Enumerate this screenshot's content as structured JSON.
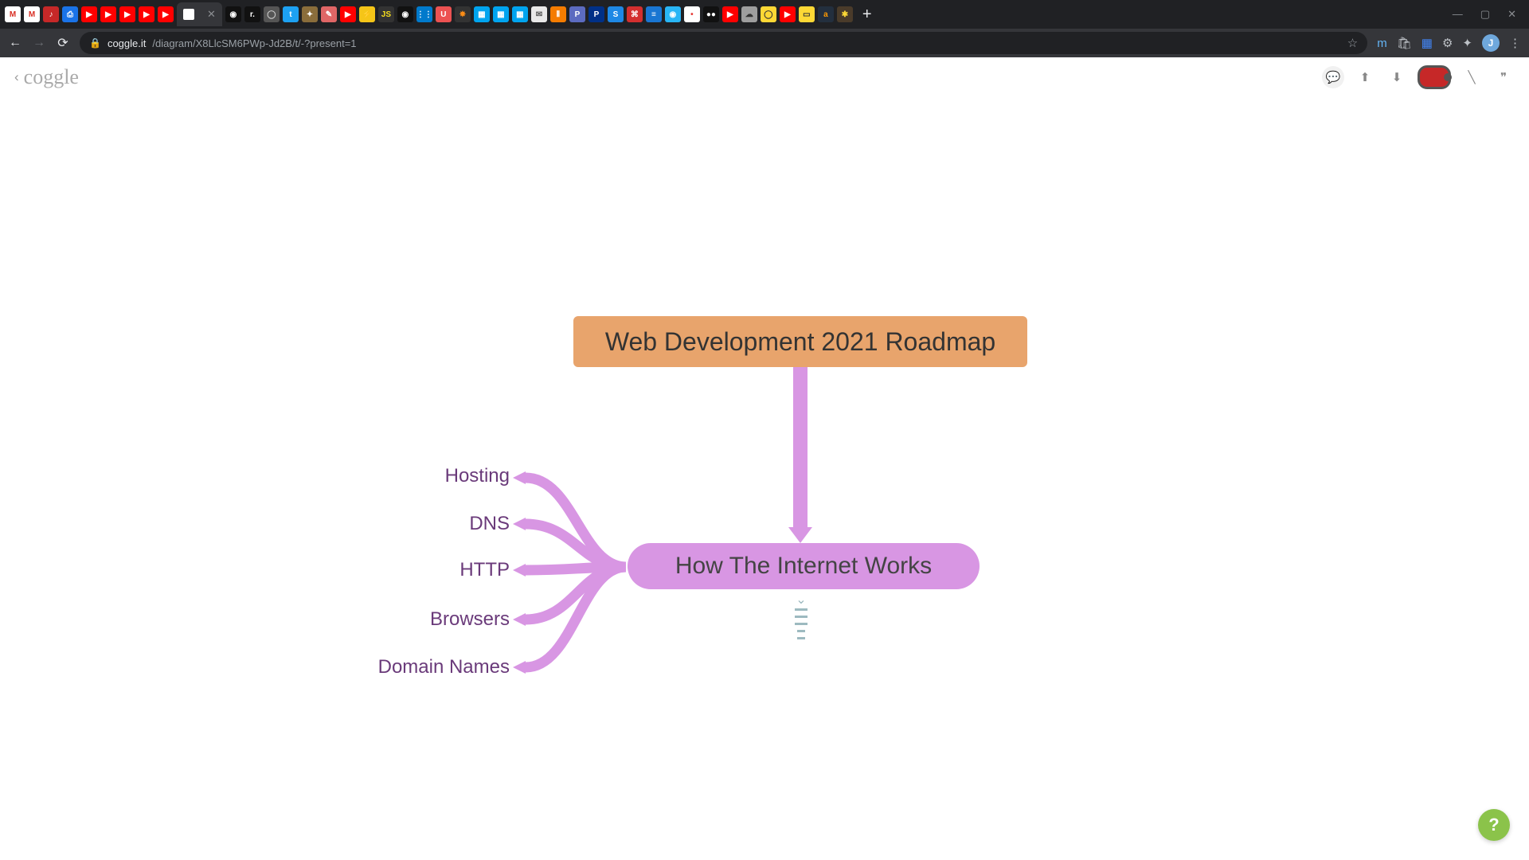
{
  "browser": {
    "url_host": "coggle.it",
    "url_path": "/diagram/X8LlcSM6PWp-Jd2B/t/-?present=1",
    "active_tab_title": "",
    "avatar_letter": "J"
  },
  "coggle": {
    "logo": "coggle",
    "help": "?"
  },
  "mindmap": {
    "root": "Web Development 2021 Roadmap",
    "child": "How The Internet Works",
    "leaves": [
      "Hosting",
      "DNS",
      "HTTP",
      "Browsers",
      "Domain Names"
    ]
  },
  "tab_favicons": [
    {
      "bg": "#ffffff",
      "fg": "#d93025",
      "txt": "M"
    },
    {
      "bg": "#ffffff",
      "fg": "#d93025",
      "txt": "M"
    },
    {
      "bg": "#c62828",
      "fg": "#fff",
      "txt": "♪"
    },
    {
      "bg": "#1a73e8",
      "fg": "#fff",
      "txt": "⎙"
    },
    {
      "bg": "#ff0000",
      "fg": "#fff",
      "txt": "▶"
    },
    {
      "bg": "#ff0000",
      "fg": "#fff",
      "txt": "▶"
    },
    {
      "bg": "#ff0000",
      "fg": "#fff",
      "txt": "▶"
    },
    {
      "bg": "#ff0000",
      "fg": "#fff",
      "txt": "▶"
    },
    {
      "bg": "#ff0000",
      "fg": "#fff",
      "txt": "▶"
    },
    {
      "bg": "#111",
      "fg": "#fff",
      "txt": "◉"
    },
    {
      "bg": "#111",
      "fg": "#fff",
      "txt": "r."
    },
    {
      "bg": "#555",
      "fg": "#ccc",
      "txt": "◯"
    },
    {
      "bg": "#1da1f2",
      "fg": "#fff",
      "txt": "t"
    },
    {
      "bg": "#8a6d3b",
      "fg": "#fff",
      "txt": "✦"
    },
    {
      "bg": "#e06666",
      "fg": "#fff",
      "txt": "✎"
    },
    {
      "bg": "#ff0000",
      "fg": "#fff",
      "txt": "▶"
    },
    {
      "bg": "#f5c518",
      "fg": "#000",
      "txt": "⚡"
    },
    {
      "bg": "#333",
      "fg": "#f7df1e",
      "txt": "JS"
    },
    {
      "bg": "#111",
      "fg": "#fff",
      "txt": "◉"
    },
    {
      "bg": "#007acc",
      "fg": "#fff",
      "txt": "⋮⋮"
    },
    {
      "bg": "#ec5252",
      "fg": "#fff",
      "txt": "U"
    },
    {
      "bg": "#333",
      "fg": "#fa8c16",
      "txt": "✸"
    },
    {
      "bg": "#00a4ef",
      "fg": "#fff",
      "txt": "▦"
    },
    {
      "bg": "#00a4ef",
      "fg": "#fff",
      "txt": "▦"
    },
    {
      "bg": "#00a4ef",
      "fg": "#fff",
      "txt": "▦"
    },
    {
      "bg": "#e8e8e8",
      "fg": "#555",
      "txt": "✉"
    },
    {
      "bg": "#f57c00",
      "fg": "#fff",
      "txt": "⫴"
    },
    {
      "bg": "#5c6bc0",
      "fg": "#fff",
      "txt": "P"
    },
    {
      "bg": "#003087",
      "fg": "#fff",
      "txt": "P"
    },
    {
      "bg": "#1e88e5",
      "fg": "#fff",
      "txt": "S"
    },
    {
      "bg": "#d32f2f",
      "fg": "#fff",
      "txt": "⌘"
    },
    {
      "bg": "#1976d2",
      "fg": "#fff",
      "txt": "≡"
    },
    {
      "bg": "#29b6f6",
      "fg": "#fff",
      "txt": "◉"
    },
    {
      "bg": "#fff",
      "fg": "#e53935",
      "txt": "•"
    },
    {
      "bg": "#111",
      "fg": "#fff",
      "txt": "●●"
    },
    {
      "bg": "#ff0000",
      "fg": "#fff",
      "txt": "▶"
    },
    {
      "bg": "#9e9e9e",
      "fg": "#333",
      "txt": "☁"
    },
    {
      "bg": "#fdd835",
      "fg": "#333",
      "txt": "◯"
    },
    {
      "bg": "#ff0000",
      "fg": "#fff",
      "txt": "▶"
    },
    {
      "bg": "#fdd835",
      "fg": "#333",
      "txt": "▭"
    },
    {
      "bg": "#232f3e",
      "fg": "#ff9900",
      "txt": "a"
    },
    {
      "bg": "#4a3b2a",
      "fg": "#fdd835",
      "txt": "✱"
    }
  ]
}
